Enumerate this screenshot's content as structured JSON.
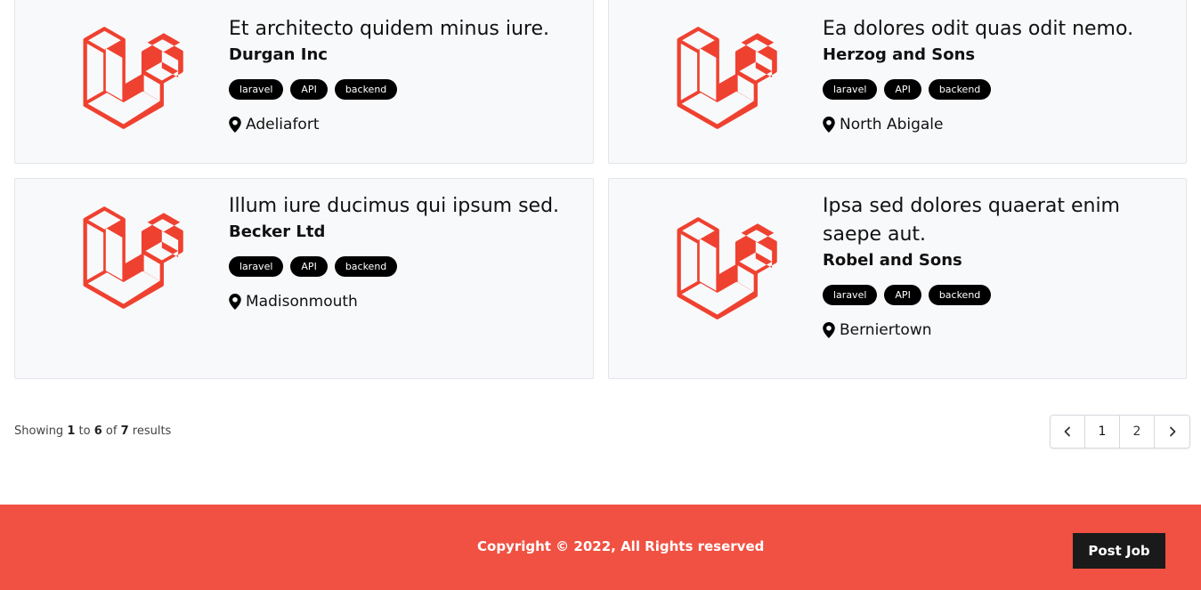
{
  "jobs": [
    {
      "title": "Et architecto quidem minus iure.",
      "company": "Durgan Inc",
      "tags": [
        "laravel",
        "API",
        "backend"
      ],
      "location": "Adeliafort"
    },
    {
      "title": "Ea dolores odit quas odit nemo.",
      "company": "Herzog and Sons",
      "tags": [
        "laravel",
        "API",
        "backend"
      ],
      "location": "North Abigale"
    },
    {
      "title": "Illum iure ducimus qui ipsum sed.",
      "company": "Becker Ltd",
      "tags": [
        "laravel",
        "API",
        "backend"
      ],
      "location": "Madisonmouth"
    },
    {
      "title": "Ipsa sed dolores quaerat enim saepe aut.",
      "company": "Robel and Sons",
      "tags": [
        "laravel",
        "API",
        "backend"
      ],
      "location": "Berniertown"
    }
  ],
  "pagination": {
    "showing_prefix": "Showing",
    "from": "1",
    "to_word": "to",
    "to": "6",
    "of_word": "of",
    "total": "7",
    "results_word": "results",
    "pages": [
      "1",
      "2"
    ],
    "prev_icon": "chevron-left-icon",
    "next_icon": "chevron-right-icon"
  },
  "footer": {
    "copyright": "Copyright © 2022, All Rights reserved",
    "post_job": "Post Job",
    "background": "#f05142"
  },
  "colors": {
    "logo_red": "#ef4130",
    "tag_bg": "#000000",
    "card_bg": "#f8f9fb"
  }
}
